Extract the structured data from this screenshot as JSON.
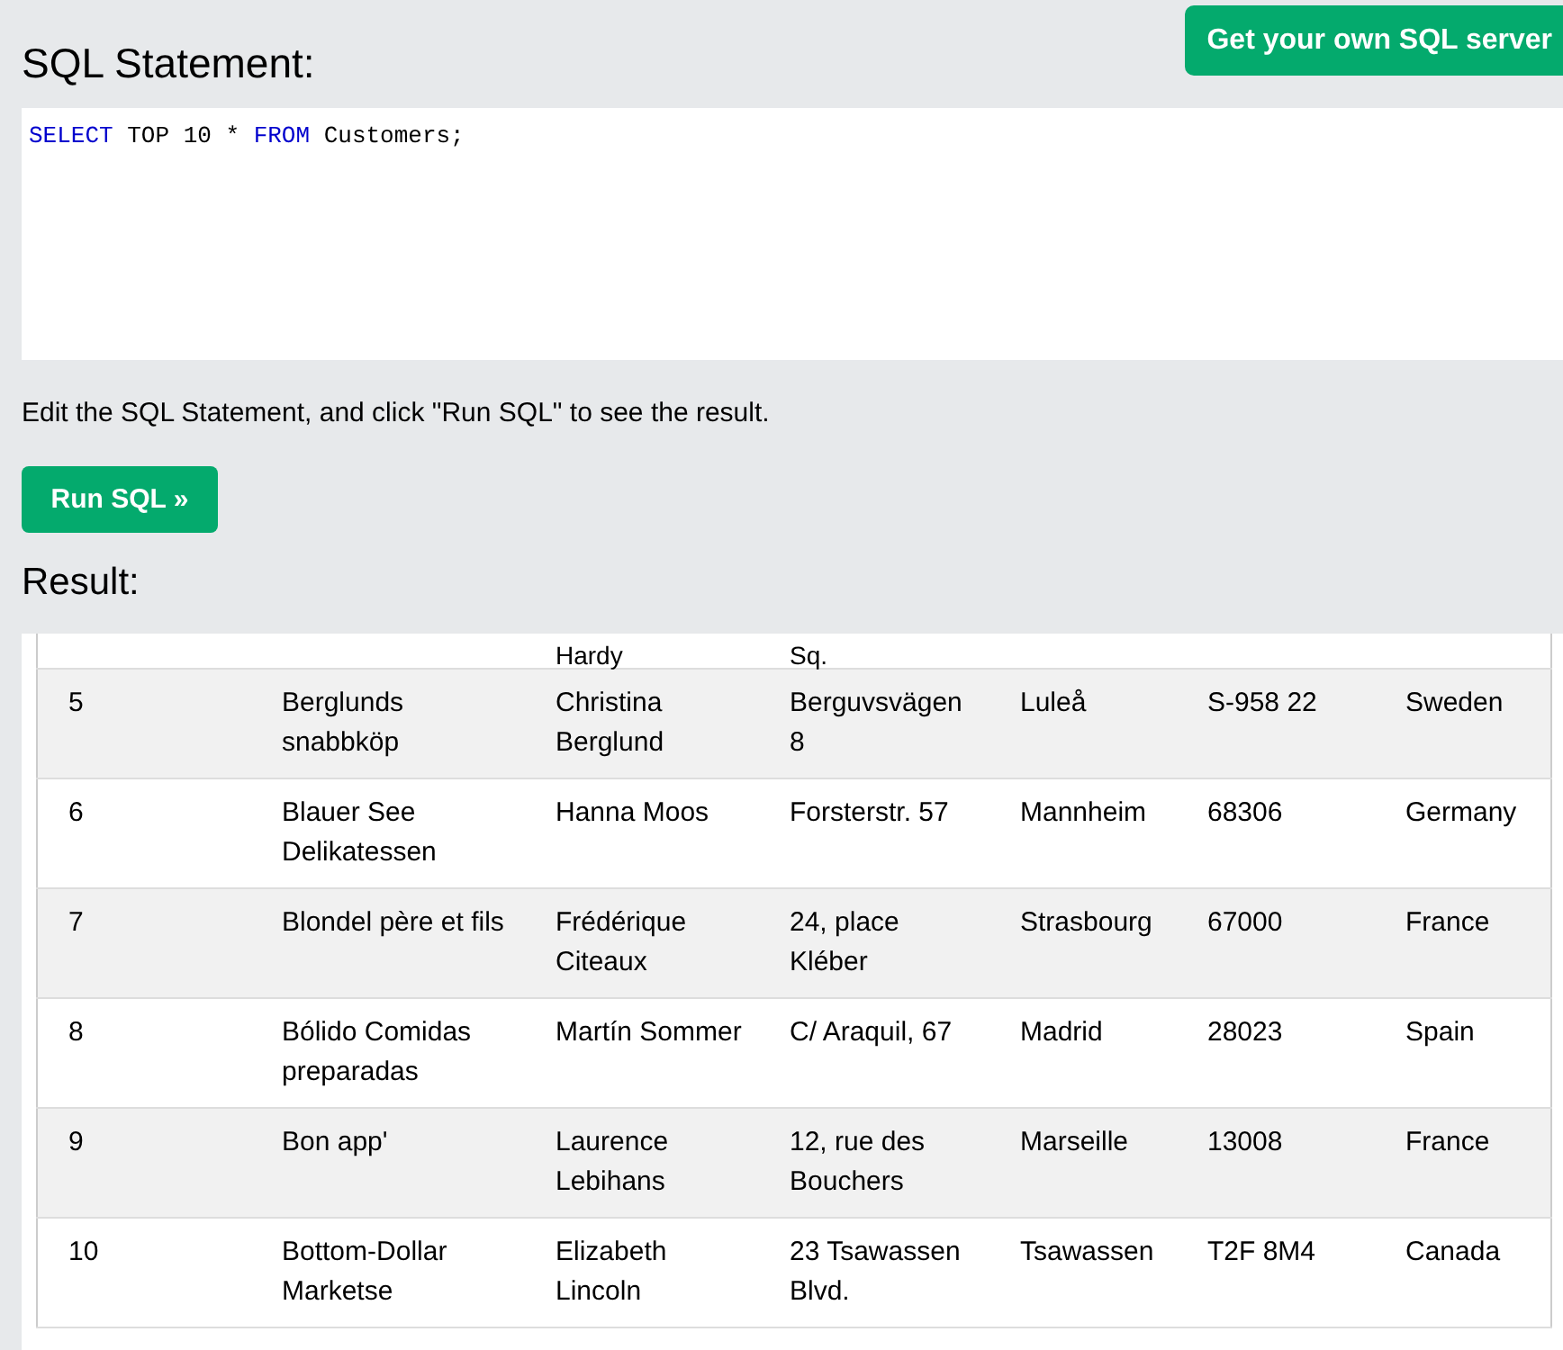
{
  "header": {
    "title": "SQL Statement:",
    "server_button": "Get your own SQL server"
  },
  "editor": {
    "tokens": [
      {
        "kind": "keyword",
        "text": "SELECT"
      },
      {
        "kind": "plain",
        "text": " TOP 10 * "
      },
      {
        "kind": "keyword",
        "text": "FROM"
      },
      {
        "kind": "plain",
        "text": " Customers;"
      }
    ]
  },
  "instructions": "Edit the SQL Statement, and click \"Run SQL\" to see the result.",
  "run_button": "Run SQL »",
  "result_title": "Result:",
  "rows": [
    {
      "kind": "cut",
      "cells": [
        null,
        null,
        "Hardy",
        "Sq.",
        null,
        null,
        null
      ]
    },
    {
      "kind": "full",
      "cells": [
        "5",
        "Berglunds snabbköp",
        "Christina Berglund",
        "Berguvsvägen 8",
        "Luleå",
        "S-958 22",
        "Sweden"
      ]
    },
    {
      "kind": "full",
      "cells": [
        "6",
        "Blauer See Delikatessen",
        "Hanna Moos",
        "Forsterstr. 57",
        "Mannheim",
        "68306",
        "Germany"
      ]
    },
    {
      "kind": "full",
      "cells": [
        "7",
        "Blondel père et fils",
        "Frédérique Citeaux",
        "24, place Kléber",
        "Strasbourg",
        "67000",
        "France"
      ]
    },
    {
      "kind": "full",
      "cells": [
        "8",
        "Bólido Comidas preparadas",
        "Martín Sommer",
        "C/ Araquil, 67",
        "Madrid",
        "28023",
        "Spain"
      ]
    },
    {
      "kind": "full",
      "cells": [
        "9",
        "Bon app'",
        "Laurence Lebihans",
        "12, rue des Bouchers",
        "Marseille",
        "13008",
        "France"
      ]
    },
    {
      "kind": "full",
      "cells": [
        "10",
        "Bottom-Dollar Marketse",
        "Elizabeth Lincoln",
        "23 Tsawassen Blvd.",
        "Tsawassen",
        "T2F 8M4",
        "Canada"
      ]
    }
  ]
}
